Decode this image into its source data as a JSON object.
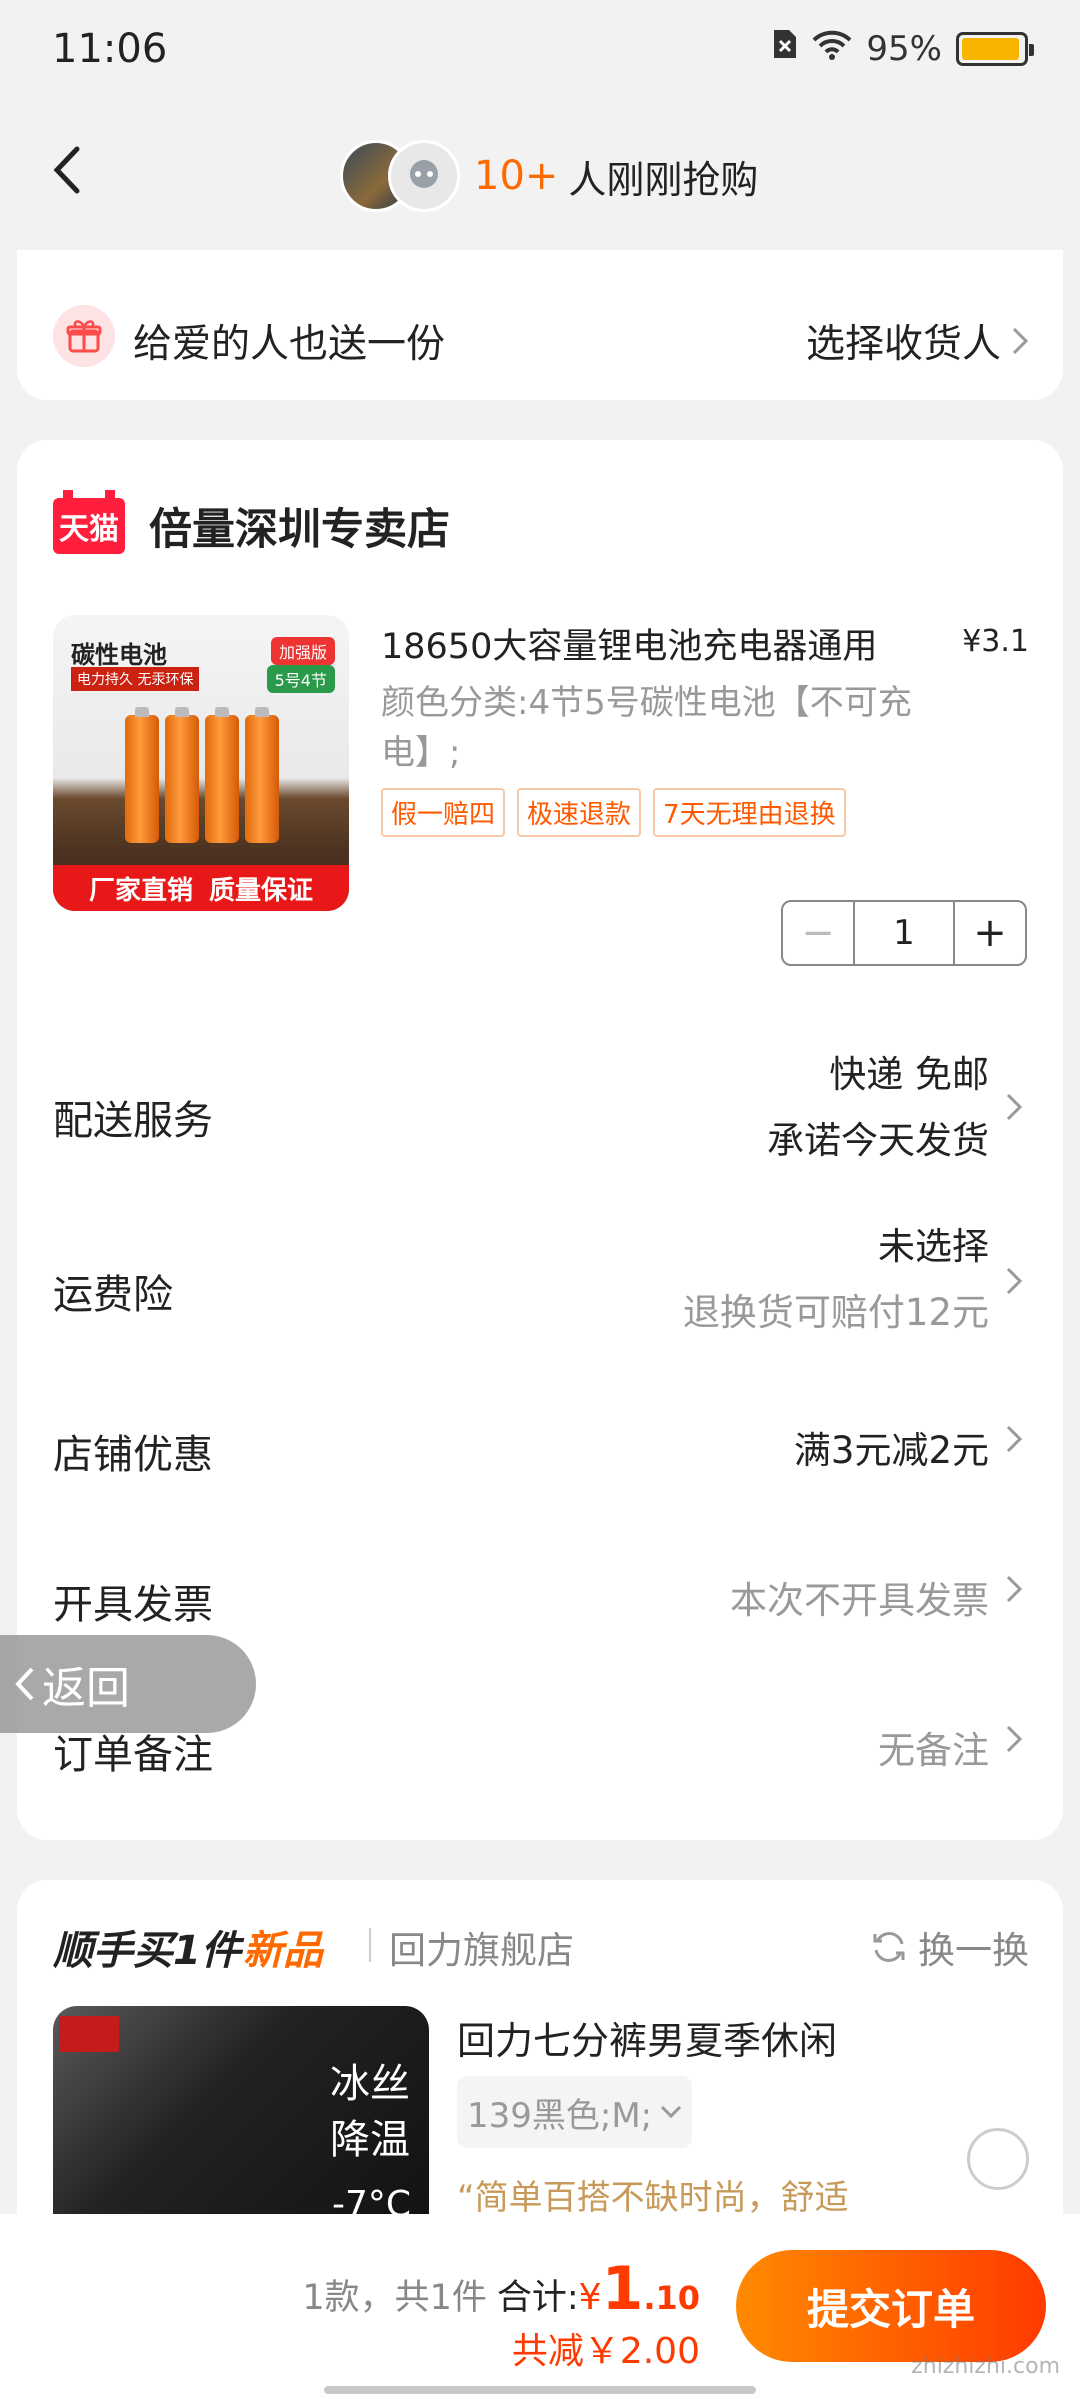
{
  "status_bar": {
    "time": "11:06",
    "battery": "95%",
    "battery_level": 0.95
  },
  "header": {
    "count": "10+",
    "text": "人刚刚抢购"
  },
  "gift": {
    "text": "给爱的人也送一份",
    "action": "选择收货人"
  },
  "shop": {
    "logo_text": "天猫",
    "name": "倍量深圳专卖店"
  },
  "product": {
    "image": {
      "title": "碳性电池",
      "sub": "电力持久 无汞环保",
      "tag1": "加强版",
      "tag2": "5号4节",
      "banner_left": "厂家直销",
      "banner_right": "质量保证"
    },
    "title": "18650大容量锂电池充电器通用",
    "price": "¥3.1",
    "spec": "颜色分类:4节5号碳性电池【不可充电】;",
    "tags": [
      "假一赔四",
      "极速退款",
      "7天无理由退换"
    ],
    "quantity": "1",
    "minus": "−",
    "plus": "+"
  },
  "rows": {
    "delivery": {
      "label": "配送服务",
      "line1": "快递 免邮",
      "line2": "承诺今天发货"
    },
    "insurance": {
      "label": "运费险",
      "line1": "未选择",
      "line2": "退换货可赔付12元"
    },
    "discount": {
      "label": "店铺优惠",
      "value": "满3元减2元"
    },
    "invoice": {
      "label": "开具发票",
      "value": "本次不开具发票"
    },
    "remark": {
      "label": "订单备注",
      "value": "无备注"
    }
  },
  "float_back": {
    "label": "返回"
  },
  "recommend": {
    "title": "顺手买1件",
    "new": "新品",
    "shop": "回力旗舰店",
    "swap": "换一换",
    "image_text": "冰丝降温",
    "image_temp": "-7°C",
    "name": "回力七分裤男夏季休闲",
    "spec": "139黑色;M;",
    "desc": "“简单百搭不缺时尚，舒适"
  },
  "bottom": {
    "count": "1款，共1件",
    "total_label": "合计:",
    "currency": "¥",
    "total_int": "1",
    "total_dec": ".10",
    "discount": "共减￥2.00",
    "submit": "提交订单",
    "watermark": "zhizhizhi.com"
  }
}
